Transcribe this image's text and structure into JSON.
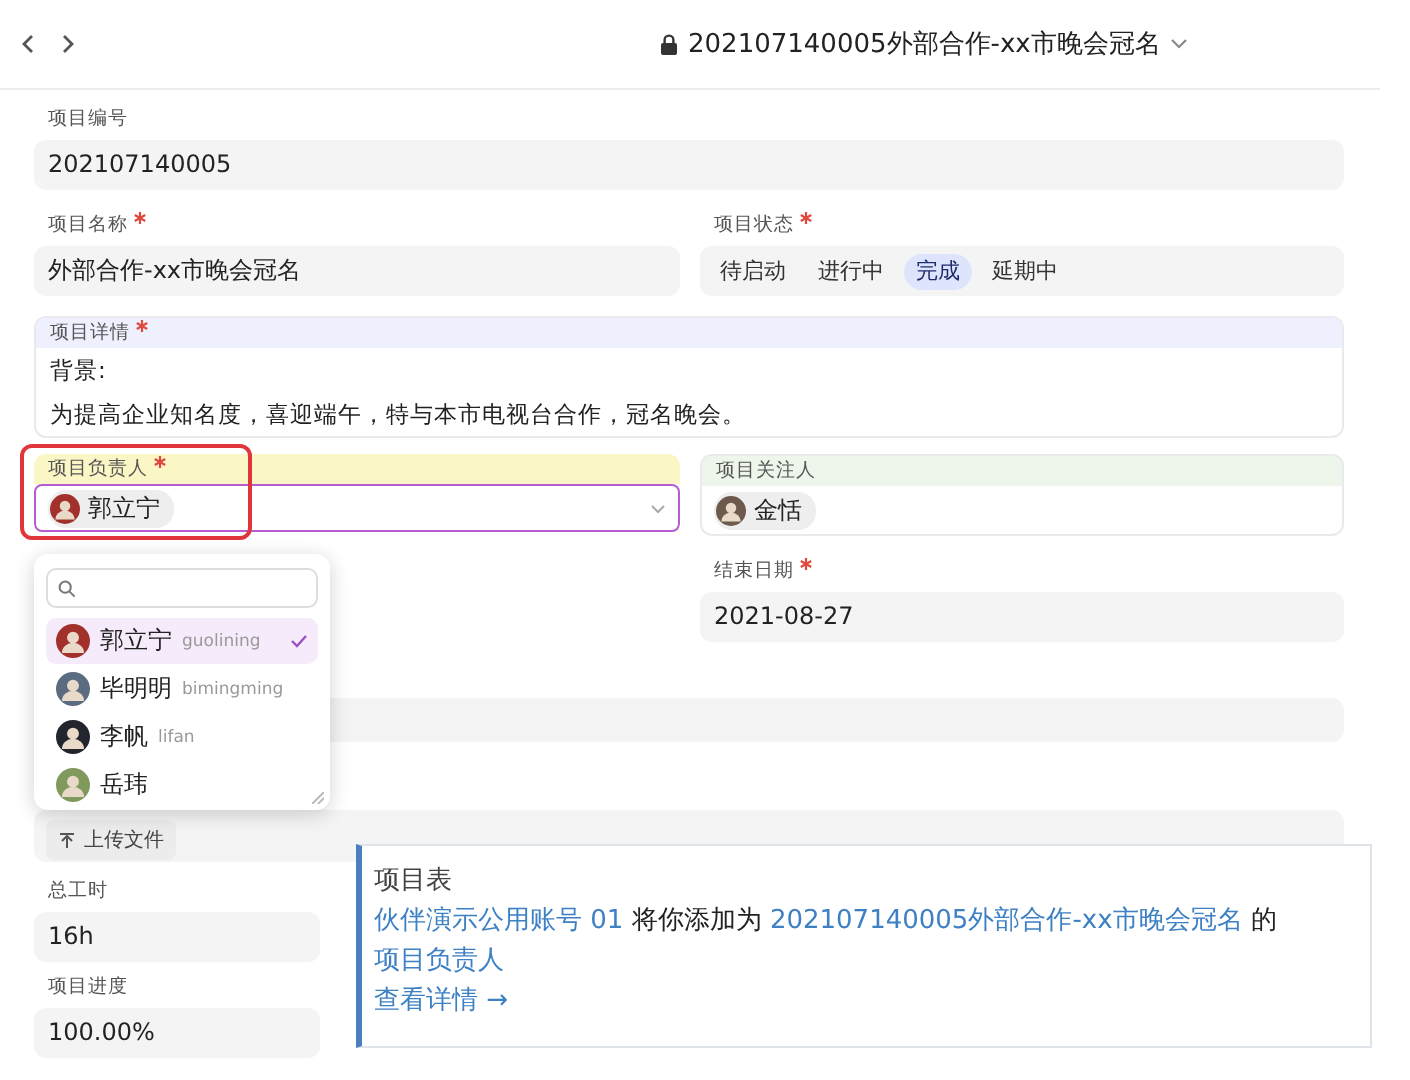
{
  "header": {
    "title": "202107140005外部合作-xx市晚会冠名"
  },
  "project_number": {
    "label": "项目编号",
    "value": "202107140005"
  },
  "project_name": {
    "label": "项目名称",
    "required": true,
    "value": "外部合作-xx市晚会冠名"
  },
  "project_status": {
    "label": "项目状态",
    "required": true,
    "options": [
      {
        "label": "待启动",
        "selected": false
      },
      {
        "label": "进行中",
        "selected": false
      },
      {
        "label": "完成",
        "selected": true
      },
      {
        "label": "延期中",
        "selected": false
      }
    ]
  },
  "project_details": {
    "label": "项目详情",
    "required": true,
    "lines": [
      "背景:",
      "为提高企业知名度，喜迎端午，特与本市电视台合作，冠名晚会。"
    ]
  },
  "owner": {
    "label": "项目负责人",
    "required": true,
    "user": "郭立宁",
    "highlighted": true
  },
  "followers": {
    "label": "项目关注人",
    "users": [
      "金恬"
    ]
  },
  "end_date": {
    "label": "结束日期",
    "required": true,
    "value": "2021-08-27"
  },
  "attachment": {
    "button": "上传文件"
  },
  "total_hours": {
    "label": "总工时",
    "value": "16h"
  },
  "progress": {
    "label": "项目进度",
    "value": "100.00%"
  },
  "user_dropdown": {
    "options": [
      {
        "name": "郭立宁",
        "username": "guolining",
        "selected": true
      },
      {
        "name": "毕明明",
        "username": "bimingming",
        "selected": false
      },
      {
        "name": "李帆",
        "username": "lifan",
        "selected": false
      },
      {
        "name": "岳玮",
        "selected": false
      }
    ]
  },
  "notification": {
    "title": "项目表",
    "actor": "伙伴演示公用账号 01",
    "verb": "将你添加为",
    "record": "202107140005外部合作-xx市晚会冠名",
    "connector": "的",
    "role": "项目负责人",
    "link": "查看详情 →"
  }
}
